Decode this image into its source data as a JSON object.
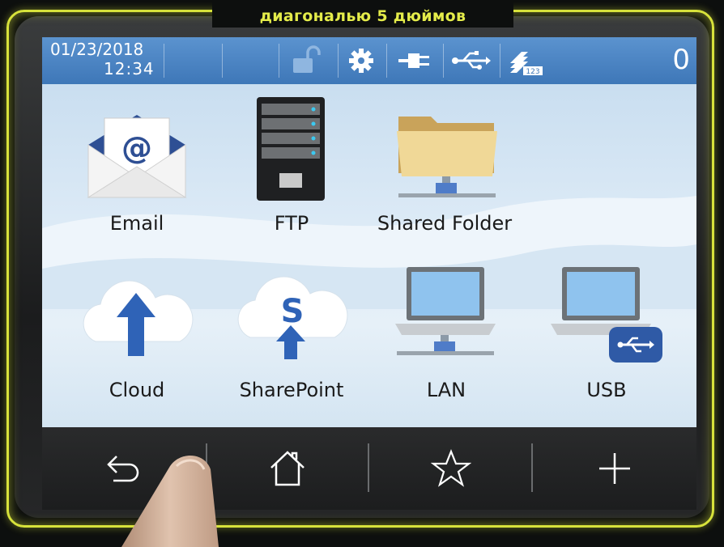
{
  "caption": "диагональю 5 дюймов",
  "status": {
    "date": "01/23/2018",
    "time": "12:34",
    "count": "0",
    "icons": [
      "lock-open-icon",
      "gear-icon",
      "network-plug-icon",
      "usb-icon",
      "stack-counter-icon"
    ],
    "counter_badge": "123",
    "accent": "#4a86c6"
  },
  "tiles": [
    {
      "id": "email",
      "label": "Email",
      "icon": "email-envelope-icon"
    },
    {
      "id": "ftp",
      "label": "FTP",
      "icon": "server-icon"
    },
    {
      "id": "shared-folder",
      "label": "Shared Folder",
      "icon": "shared-folder-icon"
    },
    {
      "id": "cloud",
      "label": "Cloud",
      "icon": "cloud-upload-icon"
    },
    {
      "id": "sharepoint",
      "label": "SharePoint",
      "icon": "sharepoint-cloud-icon"
    },
    {
      "id": "lan",
      "label": "LAN",
      "icon": "laptop-lan-icon"
    },
    {
      "id": "usb",
      "label": "USB",
      "icon": "laptop-usb-icon"
    }
  ],
  "email_glyph": "@",
  "sharepoint_glyph": "S",
  "nav": [
    {
      "id": "back",
      "icon": "back-arrow-icon"
    },
    {
      "id": "home",
      "icon": "home-icon"
    },
    {
      "id": "favorite",
      "icon": "star-icon"
    },
    {
      "id": "add",
      "icon": "plus-icon"
    }
  ]
}
